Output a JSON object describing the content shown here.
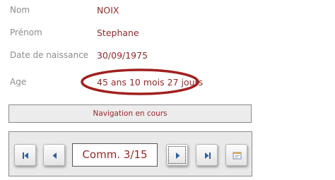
{
  "fields": [
    {
      "label": "Nom",
      "value": "NOIX"
    },
    {
      "label": "Prénom",
      "value": "Stephane"
    },
    {
      "label": "Date de naissance",
      "value": "30/09/1975"
    },
    {
      "label": "Age",
      "value": "45 ans 10 mois 27 jours"
    }
  ],
  "status": {
    "text": "Navigation en cours"
  },
  "navigation": {
    "record_indicator": "Comm. 3/15",
    "buttons": [
      {
        "name": "first-record",
        "icon": "first-record-icon"
      },
      {
        "name": "previous-record",
        "icon": "previous-record-icon"
      },
      {
        "name": "next-record",
        "icon": "next-record-icon"
      },
      {
        "name": "last-record",
        "icon": "last-record-icon"
      },
      {
        "name": "new-record",
        "icon": "new-record-icon"
      }
    ]
  },
  "colors": {
    "label": "#8c8c8c",
    "value": "#8e2b2b",
    "oval": "#a02020",
    "icon": "#2f5f9e",
    "panel_bg": "#e9e9e9"
  }
}
